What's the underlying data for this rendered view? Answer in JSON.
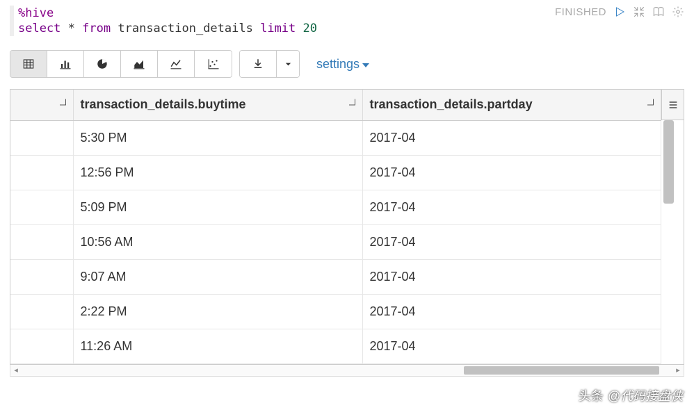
{
  "status": "FINISHED",
  "code": {
    "interpreter": "%hive",
    "select": "select",
    "star": "*",
    "from": "from",
    "table": "transaction_details",
    "limit": "limit",
    "n": "20"
  },
  "settings_label": "settings",
  "table": {
    "columns": [
      "",
      "transaction_details.buytime",
      "transaction_details.partday"
    ],
    "rows": [
      [
        "",
        "5:30 PM",
        "2017-04"
      ],
      [
        "",
        "12:56 PM",
        "2017-04"
      ],
      [
        "",
        "5:09 PM",
        "2017-04"
      ],
      [
        "",
        "10:56 AM",
        "2017-04"
      ],
      [
        "",
        "9:07 AM",
        "2017-04"
      ],
      [
        "",
        "2:22 PM",
        "2017-04"
      ],
      [
        "",
        "11:26 AM",
        "2017-04"
      ]
    ]
  },
  "watermark": {
    "prefix": "头条",
    "author": "@代码接盘侠"
  }
}
